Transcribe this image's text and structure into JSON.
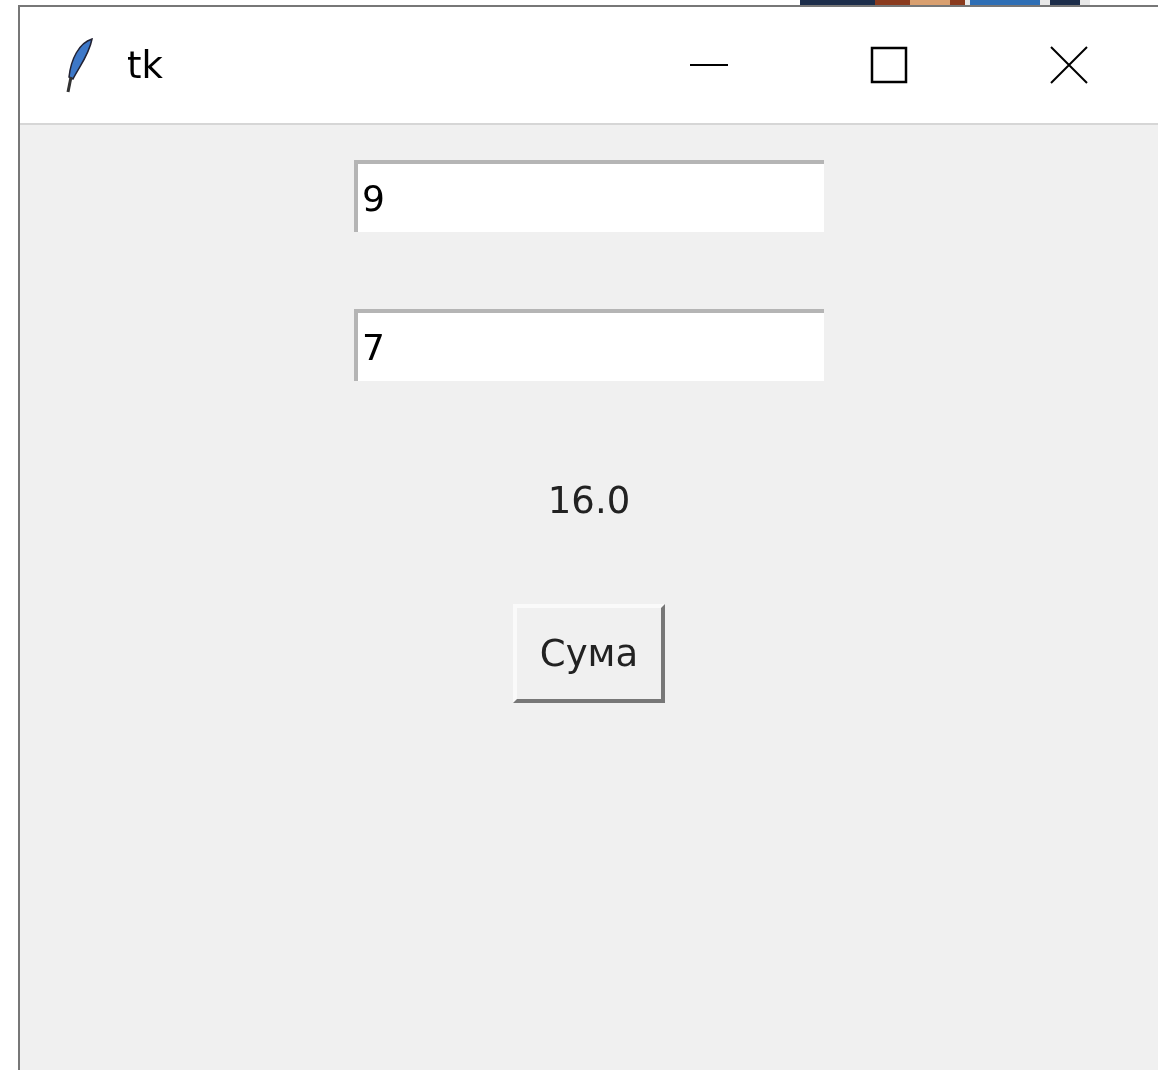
{
  "window": {
    "title": "tk"
  },
  "fields": [
    {
      "value": "9"
    },
    {
      "value": "7"
    }
  ],
  "result": "16.0",
  "button": "Сума"
}
